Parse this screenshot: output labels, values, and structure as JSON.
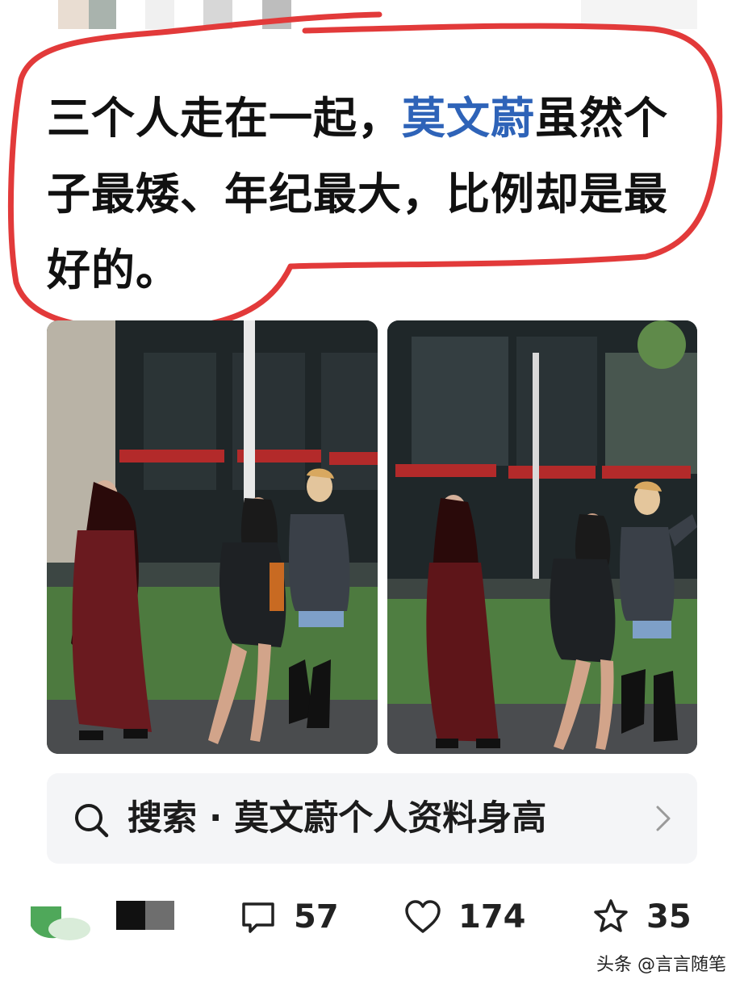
{
  "post": {
    "headline_parts": {
      "before": "三个人走在一起，",
      "highlight": "莫文蔚",
      "after": "虽然个子最矮、年纪最大，比例却是最好的。"
    },
    "highlight_color": "#2e63b8",
    "annotation_color": "#e23a3a"
  },
  "photos": [
    {
      "name": "photo-left",
      "icon": "street-photo"
    },
    {
      "name": "photo-right",
      "icon": "street-photo"
    }
  ],
  "search": {
    "icon": "search-icon",
    "text": "搜索 · 莫文蔚个人资料身高",
    "chevron": "chevron-right-icon"
  },
  "actions": {
    "comment_count": "57",
    "like_count": "174",
    "star_count": "35"
  },
  "watermark": {
    "text": "头条 @言言随笔"
  }
}
